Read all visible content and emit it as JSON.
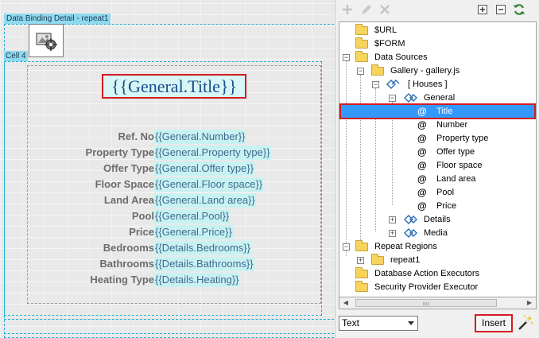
{
  "canvas": {
    "region_tag": "Data Binding Detail - repeat1",
    "cell_tag": "Cell 4",
    "title_binding": "{{General.Title}}",
    "fields": [
      {
        "label": "Ref. No",
        "binding": "{{General.Number}}"
      },
      {
        "label": "Property Type",
        "binding": "{{General.Property type}}"
      },
      {
        "label": "Offer Type",
        "binding": "{{General.Offer type}}"
      },
      {
        "label": "Floor Space",
        "binding": "{{General.Floor space}}"
      },
      {
        "label": "Land Area",
        "binding": "{{General.Land area}}"
      },
      {
        "label": "Pool",
        "binding": "{{General.Pool}}"
      },
      {
        "label": "Price",
        "binding": "{{General.Price}}"
      },
      {
        "label": "Bedrooms",
        "binding": "{{Details.Bedrooms}}"
      },
      {
        "label": "Bathrooms",
        "binding": "{{Details.Bathrooms}}"
      },
      {
        "label": "Heating Type",
        "binding": "{{Details.Heating}}"
      }
    ]
  },
  "panel": {
    "toolbar": {
      "add_icon": "plus-icon",
      "edit_icon": "pencil-icon",
      "delete_icon": "x-icon",
      "expand_all_icon": "expand-all-icon",
      "collapse_all_icon": "collapse-all-icon",
      "refresh_icon": "refresh-icon"
    },
    "tree": {
      "url": "$URL",
      "form": "$FORM",
      "data_sources": "Data Sources",
      "gallery": "Gallery - gallery.js",
      "houses": "[ Houses ]",
      "general": "General",
      "general_items": [
        "Title",
        "Number",
        "Property type",
        "Offer type",
        "Floor space",
        "Land area",
        "Pool",
        "Price"
      ],
      "selected": "Title",
      "details": "Details",
      "media": "Media",
      "repeat_regions": "Repeat Regions",
      "repeat1": "repeat1",
      "db_action": "Database Action Executors",
      "security": "Security Provider Executor"
    },
    "format_select": "Text",
    "insert_label": "Insert",
    "wand_icon": "magic-wand-icon"
  },
  "colors": {
    "selection": "#3399ff",
    "highlight_border": "#d31c20",
    "binding_bg": "#c8f2f2",
    "region_border": "#1ab0d8"
  }
}
